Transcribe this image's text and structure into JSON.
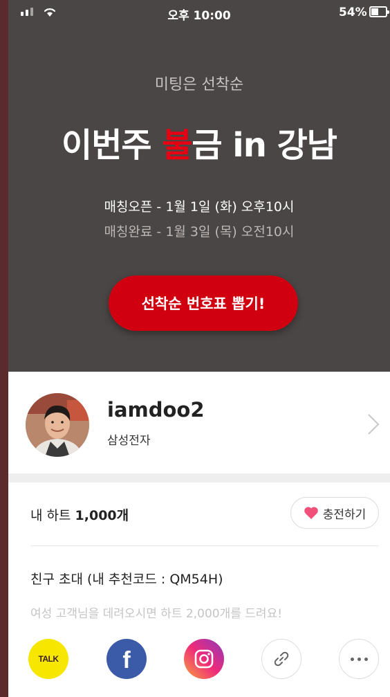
{
  "status_bar": {
    "time": "오후 10:00",
    "battery_percent": "54%",
    "battery_level": 0.54
  },
  "hero": {
    "subtitle": "미팅은 선착순",
    "title_before": "이번주 ",
    "title_accent": "불",
    "title_after": "금 in 강남",
    "match_open": "매칭오픈 - 1월 1일 (화) 오후10시",
    "match_close": "매칭완료 - 1월 3일 (목) 오전10시",
    "cta_label": "선착순 번호표 뽑기!"
  },
  "profile": {
    "username": "iamdoo2",
    "company": "삼성전자"
  },
  "hearts": {
    "label_prefix": "내 하트 ",
    "count": "1,000개",
    "charge_label": "충전하기"
  },
  "invite": {
    "title": "친구 초대 (내 추천코드 : QM54H)",
    "description": "여성 고객님을 데려오시면 하트 2,000개를 드려요!"
  },
  "share": {
    "kakao_label": "TALK",
    "facebook_label": "f"
  },
  "colors": {
    "hero_bg": "#4a4645",
    "accent_red": "#e60012",
    "cta_red": "#d00010",
    "kakao_yellow": "#f7e600",
    "facebook_blue": "#3b5ba8"
  }
}
